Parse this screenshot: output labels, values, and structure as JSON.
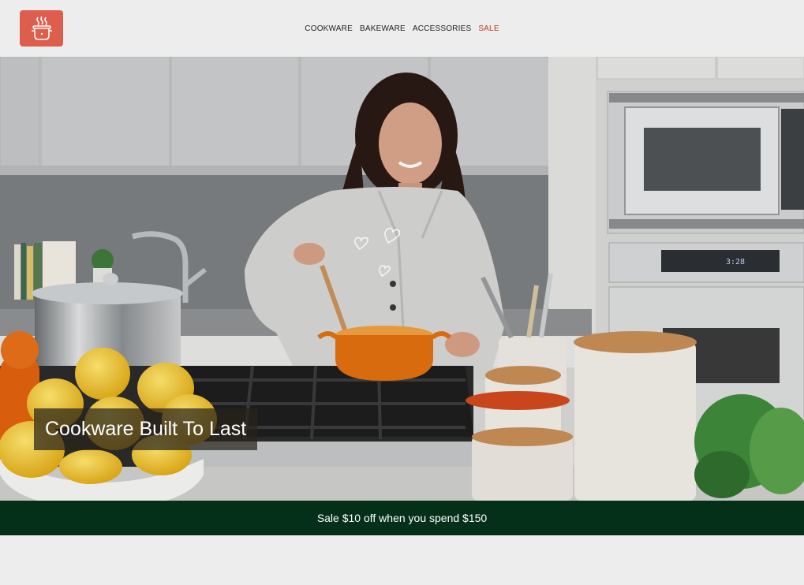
{
  "header": {
    "logo_icon": "cooking-pot-icon",
    "nav": [
      {
        "label": "COOKWARE"
      },
      {
        "label": "BAKEWARE"
      },
      {
        "label": "ACCESSORIES"
      },
      {
        "label": "SALE"
      }
    ]
  },
  "hero": {
    "title": "Cookware Built To Last"
  },
  "banner": {
    "text": "Sale $10 off when you spend $150"
  },
  "colors": {
    "logo_bg": "#dd5e4c",
    "sale_link": "#c7361f",
    "banner_bg": "#04301a",
    "page_bg": "#ededed"
  }
}
